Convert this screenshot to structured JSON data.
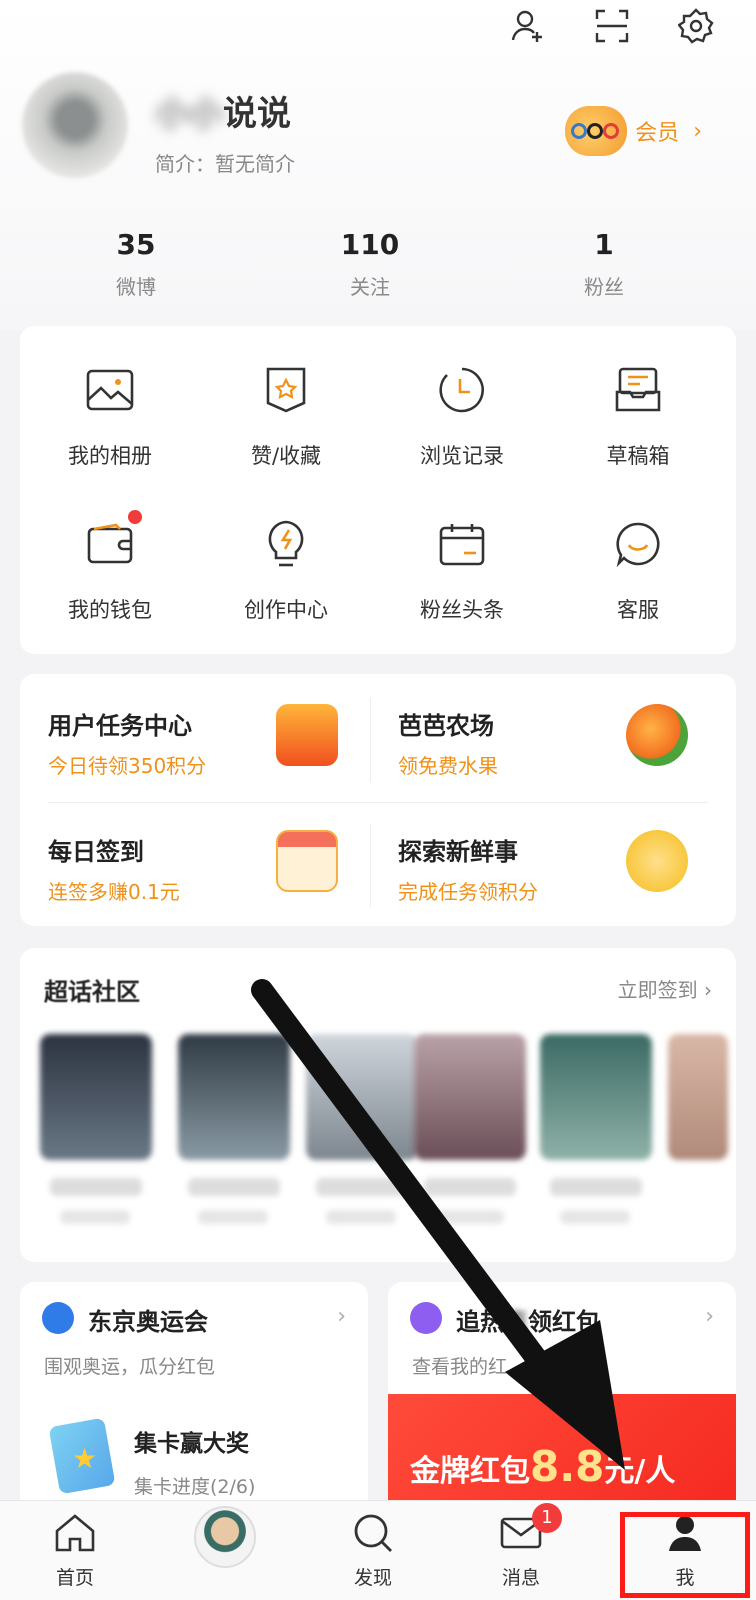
{
  "profile": {
    "username_visible": "说说",
    "bio": "简介：暂无简介",
    "member_label": "会员"
  },
  "stats": [
    {
      "num": "35",
      "label": "微博"
    },
    {
      "num": "110",
      "label": "关注"
    },
    {
      "num": "1",
      "label": "粉丝"
    }
  ],
  "grid": [
    {
      "label": "我的相册",
      "icon": "photo-album-icon"
    },
    {
      "label": "赞/收藏",
      "icon": "bookmark-icon"
    },
    {
      "label": "浏览记录",
      "icon": "history-icon"
    },
    {
      "label": "草稿箱",
      "icon": "drafts-icon"
    },
    {
      "label": "我的钱包",
      "icon": "wallet-icon"
    },
    {
      "label": "创作中心",
      "icon": "lightbulb-icon"
    },
    {
      "label": "粉丝头条",
      "icon": "calendar-icon"
    },
    {
      "label": "客服",
      "icon": "chat-icon"
    }
  ],
  "tasks": [
    {
      "title": "用户任务中心",
      "sub": "今日待领350积分"
    },
    {
      "title": "芭芭农场",
      "sub": "领免费水果"
    },
    {
      "title": "每日签到",
      "sub": "连签多赚0.1元"
    },
    {
      "title": "探索新鲜事",
      "sub": "完成任务领积分"
    }
  ],
  "super": {
    "title": "超话社区",
    "action": "立即签到"
  },
  "olympics": {
    "title": "东京奥运会",
    "sub": "围观奥运，瓜分红包",
    "card_title": "集卡赢大奖",
    "card_sub": "集卡进度(2/6)"
  },
  "hot": {
    "title_a": "追热",
    "title_b": "领红包",
    "sub": "查看我的红",
    "banner_a": "金牌红包",
    "banner_amount": "8.8",
    "banner_b": "元/人"
  },
  "tabs": [
    {
      "label": "首页"
    },
    {
      "label": ""
    },
    {
      "label": "发现"
    },
    {
      "label": "消息",
      "badge": "1"
    },
    {
      "label": "我"
    }
  ],
  "colors": {
    "accent": "#f09119",
    "highlight_box": "#ff1a1a",
    "badge": "#f23b3b"
  }
}
